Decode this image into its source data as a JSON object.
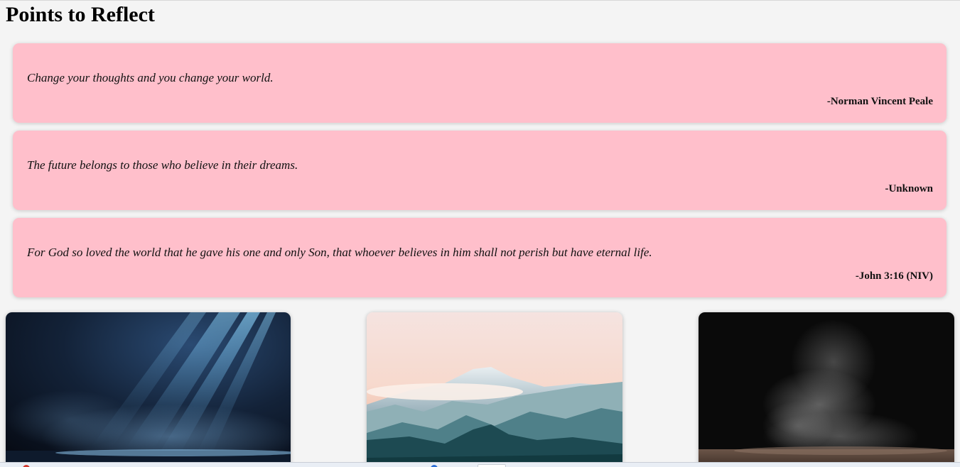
{
  "page": {
    "title": "Points to Reflect"
  },
  "quotes": [
    {
      "text": "Change your thoughts and you change your world.",
      "author": "-Norman Vincent Peale"
    },
    {
      "text": "The future belongs to those who believe in their dreams.",
      "author": "-Unknown"
    },
    {
      "text": "For God so loved the world that he gave his one and only Son, that whoever believes in him shall not perish but have eternal life.",
      "author": "-John 3:16 (NIV)"
    }
  ],
  "images": [
    {
      "name": "light-rays-image"
    },
    {
      "name": "mountain-landscape-image"
    },
    {
      "name": "smoke-stage-image"
    }
  ],
  "colors": {
    "card_background": "#ffbfcb",
    "page_background": "#f4f4f4"
  }
}
